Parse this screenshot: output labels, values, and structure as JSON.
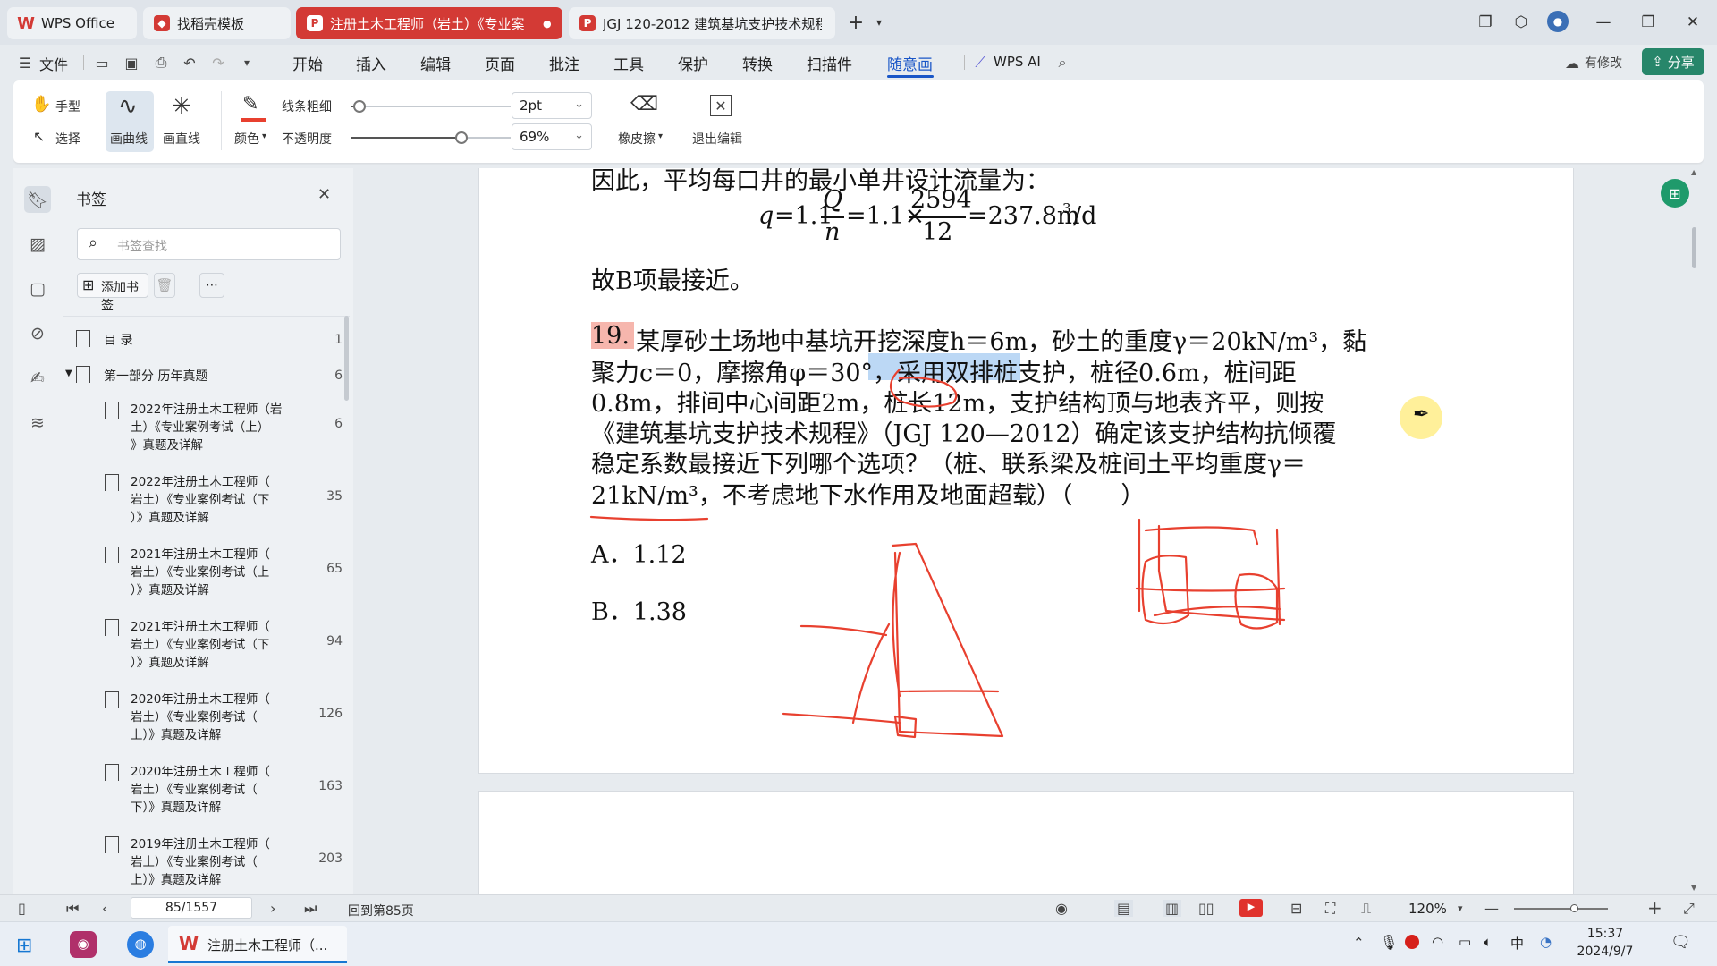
{
  "tabs": [
    {
      "label": "WPS Office",
      "icon": "wps-logo-icon"
    },
    {
      "label": "找稻壳模板",
      "icon": "docer-icon"
    },
    {
      "label": "注册土木工程师（岩土）《专业案",
      "icon": "pdf-icon",
      "active": true
    },
    {
      "label": "JGJ 120-2012 建筑基坑支护技术规程",
      "icon": "pdf-icon"
    }
  ],
  "menu": {
    "file": "文件",
    "items": [
      "开始",
      "插入",
      "编辑",
      "页面",
      "批注",
      "工具",
      "保护",
      "转换",
      "扫描件",
      "随意画"
    ],
    "active": "随意画",
    "wps_ai": "WPS AI",
    "has_changes": "有修改",
    "share": "分享"
  },
  "toolbar": {
    "hand": "手型",
    "select": "选择",
    "draw_curve": "画曲线",
    "draw_line": "画直线",
    "color": "颜色",
    "line_width_label": "线条粗细",
    "line_width_value": "2pt",
    "opacity_label": "不透明度",
    "opacity_value": "69%",
    "eraser": "橡皮擦",
    "exit_edit": "退出编辑",
    "line_width_slider": 0.05,
    "opacity_slider": 0.69
  },
  "bookmarks": {
    "title": "书签",
    "search_placeholder": "书签查找",
    "add_label": "添加书签",
    "items": [
      {
        "text": "目 录",
        "page": "1"
      },
      {
        "text": "第一部分 历年真题",
        "page": "6"
      },
      {
        "lines": [
          "2022年注册土木工程师（岩",
          "土）《专业案例考试（上）",
          "》真题及详解"
        ],
        "page": "6"
      },
      {
        "lines": [
          "2022年注册土木工程师（",
          "岩土）《专业案例考试（下",
          "）》真题及详解"
        ],
        "page": "35"
      },
      {
        "lines": [
          "2021年注册土木工程师（",
          "岩土）《专业案例考试（上",
          "）》真题及详解"
        ],
        "page": "65"
      },
      {
        "lines": [
          "2021年注册土木工程师（",
          "岩土）《专业案例考试（下",
          "）》真题及详解"
        ],
        "page": "94"
      },
      {
        "lines": [
          "2020年注册土木工程师（",
          "岩土）《专业案例考试（",
          "上）》真题及详解"
        ],
        "page": "126"
      },
      {
        "lines": [
          "2020年注册土木工程师（",
          "岩土）《专业案例考试（",
          "下）》真题及详解"
        ],
        "page": "163"
      },
      {
        "lines": [
          "2019年注册土木工程师（",
          "岩土）《专业案例考试（",
          "上）》真题及详解"
        ],
        "page": "203"
      }
    ]
  },
  "document": {
    "line_top": "因此，平均每口井的最小单井设计流量为：",
    "formula": {
      "q": "q",
      "eq1": "=1.1",
      "num1": "Q",
      "den1": "n",
      "eq2": "=1.1×",
      "num2": "2594",
      "den2": "12",
      "result": "=237.8m",
      "sup": "3",
      "unit": "/d"
    },
    "conclusion": "故B项最接近。",
    "q_num": "19.",
    "q_lines": [
      "某厚砂土场地中基坑开挖深度h＝6m，砂土的重度γ＝20kN/m³，黏",
      "聚力c＝0，摩擦角φ＝30°，采用双排桩支护，桩径0.6m，桩间距",
      "0.8m，排间中心间距2m，桩长12m，支护结构顶与地表齐平，则按",
      "《建筑基坑支护技术规程》（JGJ 120—2012）确定该支护结构抗倾覆",
      "稳定系数最接近下列哪个选项？（桩、联系梁及桩间土平均重度γ＝",
      "21kN/m³，不考虑地下水作用及地面超载）（　　）"
    ],
    "option_a": "A．1.12",
    "option_b": "B．1.38"
  },
  "status": {
    "page_field": "85/1557",
    "back_to_page": "回到第85页",
    "zoom": "120%"
  },
  "taskbar": {
    "app_label": "注册土木工程师（...",
    "time": "15:37",
    "date": "2024/9/7"
  },
  "colors": {
    "wps_red": "#d33a35",
    "ink_red": "#e8402f",
    "highlight_red": "#f6b6ad",
    "highlight_blue": "#bcd8f5",
    "accent_green": "#27866a"
  }
}
